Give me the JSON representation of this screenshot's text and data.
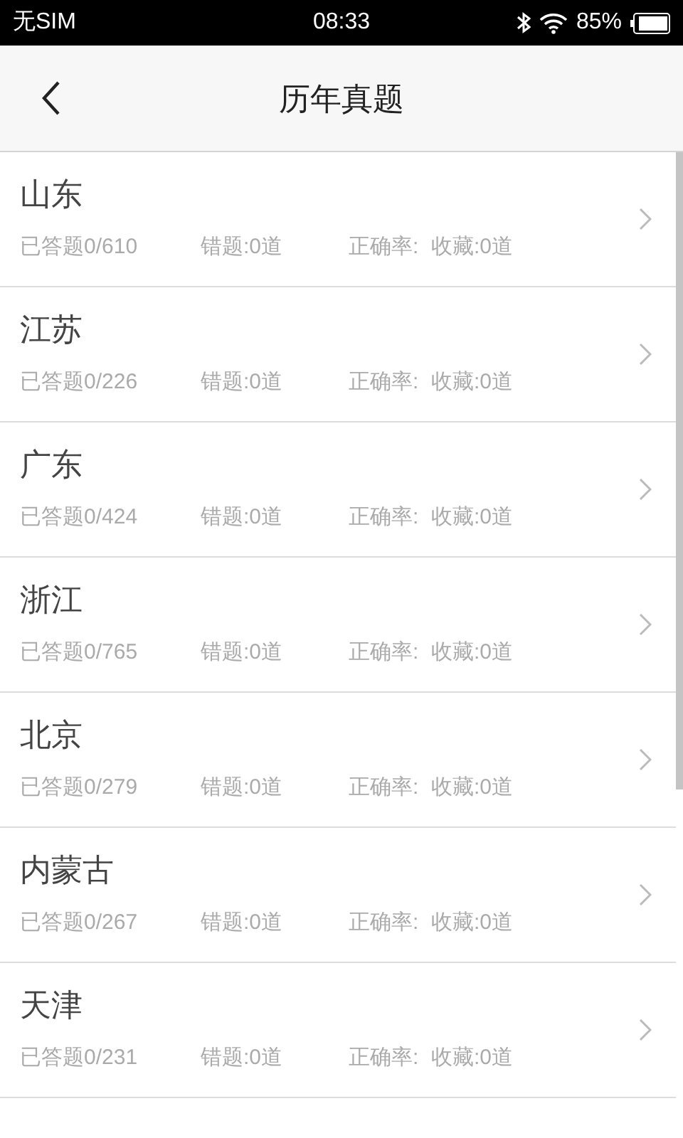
{
  "status_bar": {
    "carrier": "无SIM",
    "time": "08:33",
    "battery": "85%"
  },
  "header": {
    "title": "历年真题"
  },
  "rows": [
    {
      "name": "山东",
      "answered": "已答题0/610",
      "wrong": "错题:0道",
      "accuracy": "正确率:",
      "favorites": "收藏:0道"
    },
    {
      "name": "江苏",
      "answered": "已答题0/226",
      "wrong": "错题:0道",
      "accuracy": "正确率:",
      "favorites": "收藏:0道"
    },
    {
      "name": "广东",
      "answered": "已答题0/424",
      "wrong": "错题:0道",
      "accuracy": "正确率:",
      "favorites": "收藏:0道"
    },
    {
      "name": "浙江",
      "answered": "已答题0/765",
      "wrong": "错题:0道",
      "accuracy": "正确率:",
      "favorites": "收藏:0道"
    },
    {
      "name": "北京",
      "answered": "已答题0/279",
      "wrong": "错题:0道",
      "accuracy": "正确率:",
      "favorites": "收藏:0道"
    },
    {
      "name": "内蒙古",
      "answered": "已答题0/267",
      "wrong": "错题:0道",
      "accuracy": "正确率:",
      "favorites": "收藏:0道"
    },
    {
      "name": "天津",
      "answered": "已答题0/231",
      "wrong": "错题:0道",
      "accuracy": "正确率:",
      "favorites": "收藏:0道"
    }
  ]
}
